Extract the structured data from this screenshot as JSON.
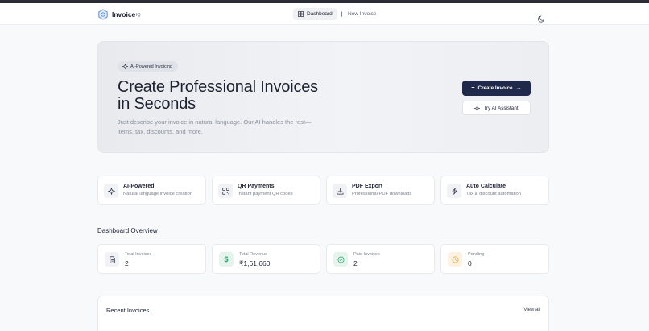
{
  "brand": {
    "name": "Invoice",
    "suffix": "IQ"
  },
  "nav": {
    "tabs": [
      {
        "label": "Dashboard",
        "icon": "grid-icon",
        "active": true
      },
      {
        "label": "New Invoice",
        "icon": "plus-icon",
        "active": false
      }
    ],
    "theme_icon": "moon-icon"
  },
  "hero": {
    "badge": "AI-Powered Invoicing",
    "title": "Create Professional Invoices in Seconds",
    "subtitle": "Just describe your invoice in natural language. Our AI handles the rest—items, tax, discounts, and more.",
    "primary_button": "Create Invoice",
    "secondary_button": "Try AI Assistant"
  },
  "features": [
    {
      "title": "AI-Powered",
      "desc": "Natural language invoice creation",
      "icon": "sparkles-icon"
    },
    {
      "title": "QR Payments",
      "desc": "Instant payment QR codes",
      "icon": "qr-code-icon"
    },
    {
      "title": "PDF Export",
      "desc": "Professional PDF downloads",
      "icon": "download-icon"
    },
    {
      "title": "Auto Calculate",
      "desc": "Tax & discount automation",
      "icon": "lightning-icon"
    }
  ],
  "dashboard": {
    "title": "Dashboard Overview",
    "stats": [
      {
        "label": "Total Invoices",
        "value": "2",
        "icon": "document-icon",
        "color": "#f1f2f5"
      },
      {
        "label": "Total Revenue",
        "value": "₹1,61,660",
        "icon": "dollar-icon",
        "color": "#e6f4ee"
      },
      {
        "label": "Paid Invoices",
        "value": "2",
        "icon": "check-circle-icon",
        "color": "#e6f4ee"
      },
      {
        "label": "Pending",
        "value": "0",
        "icon": "clock-icon",
        "color": "#fdf1e1"
      }
    ]
  },
  "recent": {
    "title": "Recent Invoices",
    "view_all": "View all"
  },
  "colors": {
    "primary": "#1f2a4a",
    "success": "#2f9e6a",
    "warning": "#e8a23a"
  }
}
